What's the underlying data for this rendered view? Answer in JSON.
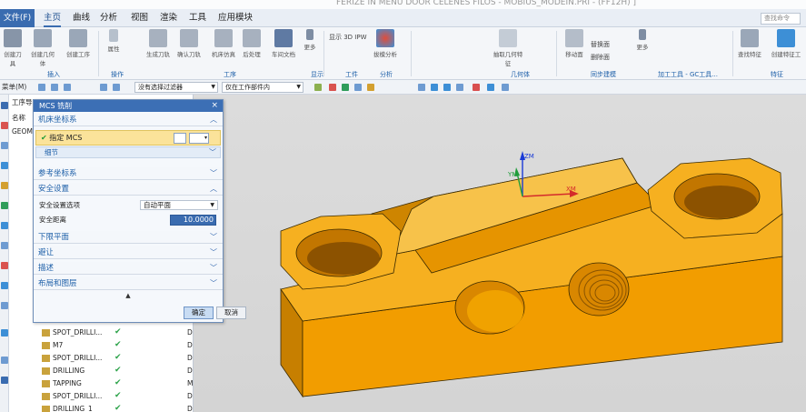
{
  "window": {
    "title": "FERIZE IN MENU DOOR CELENES FILOS - MOBIUS_MODEIN.PRI - (FF12H) ]"
  },
  "menubar": {
    "file": "文件(F)",
    "tabs": [
      "主页",
      "曲线",
      "分析",
      "视图",
      "渲染",
      "工具",
      "应用模块"
    ],
    "search_placeholder": "查找命令"
  },
  "ribbon": {
    "buttons": [
      "创建刀具",
      "创建几何体",
      "创建工序",
      "属性",
      "生成刀轨",
      "确认刀轨",
      "机床仿真",
      "后处理",
      "车间文档",
      "更多",
      "显示 3D IPW",
      "拔模分析",
      "抽取几何特征",
      "移动面",
      "更多",
      "查找特征",
      "创建特征工"
    ],
    "small_items": [
      "显示",
      "工件",
      "分析",
      "几何体",
      "替换面",
      "删除面",
      "加工工具 - GC工具..."
    ],
    "groups": [
      "插入",
      "操作",
      "工序",
      "显示",
      "工件",
      "分析",
      "几何体",
      "同步建模",
      "加工工具 - GC工具...",
      "特征"
    ]
  },
  "selbar": {
    "menu": "菜单(M)",
    "filter": "没有选择过滤器",
    "scope": "仅在工作部件内"
  },
  "navigator": {
    "header": "工序导",
    "column": "名称",
    "root": "GEOM",
    "rows": [
      {
        "name": "SPOT_DRILLI...",
        "status": "✔",
        "flag": "D"
      },
      {
        "name": "M7",
        "status": "✔",
        "flag": "D"
      },
      {
        "name": "SPOT_DRILLI...",
        "status": "✔",
        "flag": "D"
      },
      {
        "name": "DRILLING",
        "status": "✔",
        "flag": "D"
      },
      {
        "name": "TAPPING",
        "status": "✔",
        "flag": "M"
      },
      {
        "name": "SPOT_DRILLI...",
        "status": "✔",
        "flag": "D"
      },
      {
        "name": "DRILLING_1",
        "status": "✔",
        "flag": "D"
      }
    ]
  },
  "dialog": {
    "title": "MCS 铣削",
    "sections": {
      "machine_cs": "机床坐标系",
      "specify_mcs": "指定 MCS",
      "detail": "细节",
      "reference_cs": "参考坐标系",
      "safety": "安全设置",
      "safety_option_label": "安全设置选项",
      "safety_option_value": "自动平面",
      "safe_distance_label": "安全距离",
      "safe_distance_value": "10.0000",
      "lower_plane": "下限平面",
      "avoid": "避让",
      "description": "描述",
      "layout_layer": "布局和图层"
    },
    "ok": "确定",
    "cancel": "取消"
  },
  "viewport": {
    "axes": {
      "x": "XM",
      "y": "YM",
      "z": "ZM"
    },
    "part_color": "#f2a900",
    "part_top_color": "#f7c24a"
  }
}
